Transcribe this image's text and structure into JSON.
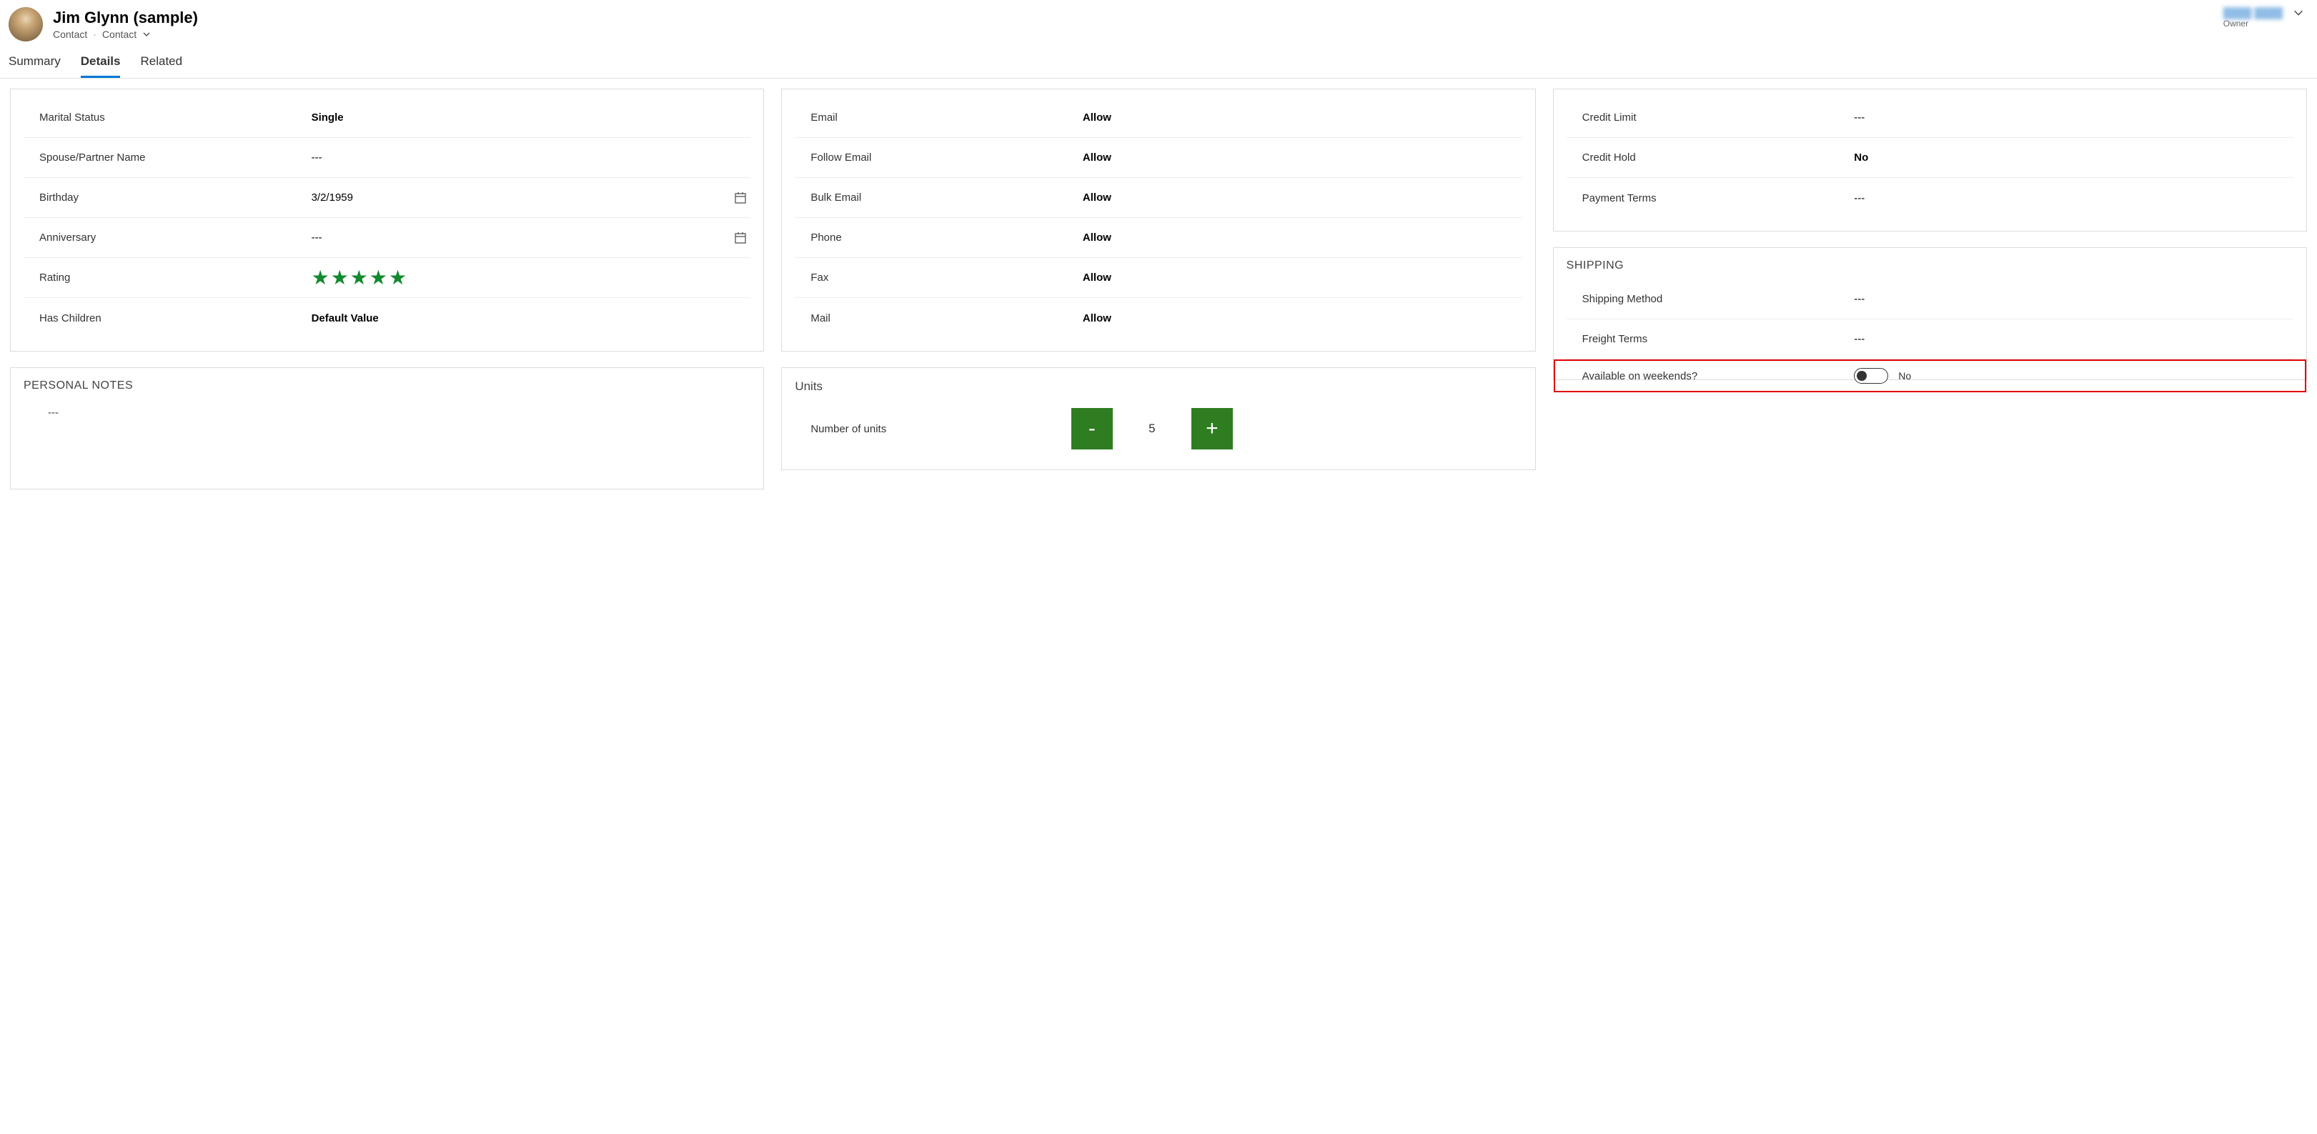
{
  "header": {
    "title": "Jim Glynn (sample)",
    "entity_type": "Contact",
    "form_selector": "Contact",
    "owner_name": "████ ████",
    "owner_label": "Owner"
  },
  "tabs": [
    {
      "label": "Summary",
      "active": false
    },
    {
      "label": "Details",
      "active": true
    },
    {
      "label": "Related",
      "active": false
    }
  ],
  "personal": {
    "fields": [
      {
        "label": "Marital Status",
        "value": "Single",
        "bold": true,
        "icon": null
      },
      {
        "label": "Spouse/Partner Name",
        "value": "---",
        "bold": false,
        "icon": null
      },
      {
        "label": "Birthday",
        "value": "3/2/1959",
        "bold": false,
        "icon": "calendar"
      },
      {
        "label": "Anniversary",
        "value": "---",
        "bold": false,
        "icon": "calendar"
      },
      {
        "label": "Rating",
        "value": "stars",
        "stars": 5,
        "bold": false,
        "icon": null
      },
      {
        "label": "Has Children",
        "value": "Default Value",
        "bold": true,
        "icon": null
      }
    ]
  },
  "personal_notes": {
    "title": "PERSONAL NOTES",
    "value": "---"
  },
  "contact_prefs": [
    {
      "label": "Email",
      "value": "Allow"
    },
    {
      "label": "Follow Email",
      "value": "Allow"
    },
    {
      "label": "Bulk Email",
      "value": "Allow"
    },
    {
      "label": "Phone",
      "value": "Allow"
    },
    {
      "label": "Fax",
      "value": "Allow"
    },
    {
      "label": "Mail",
      "value": "Allow"
    }
  ],
  "units": {
    "title": "Units",
    "label": "Number of units",
    "value": "5"
  },
  "billing": [
    {
      "label": "Credit Limit",
      "value": "---",
      "bold": false
    },
    {
      "label": "Credit Hold",
      "value": "No",
      "bold": true
    },
    {
      "label": "Payment Terms",
      "value": "---",
      "bold": false
    }
  ],
  "shipping": {
    "title": "SHIPPING",
    "fields": [
      {
        "label": "Shipping Method",
        "value": "---"
      },
      {
        "label": "Freight Terms",
        "value": "---"
      }
    ],
    "toggle": {
      "label": "Available on weekends?",
      "value": "No"
    }
  }
}
